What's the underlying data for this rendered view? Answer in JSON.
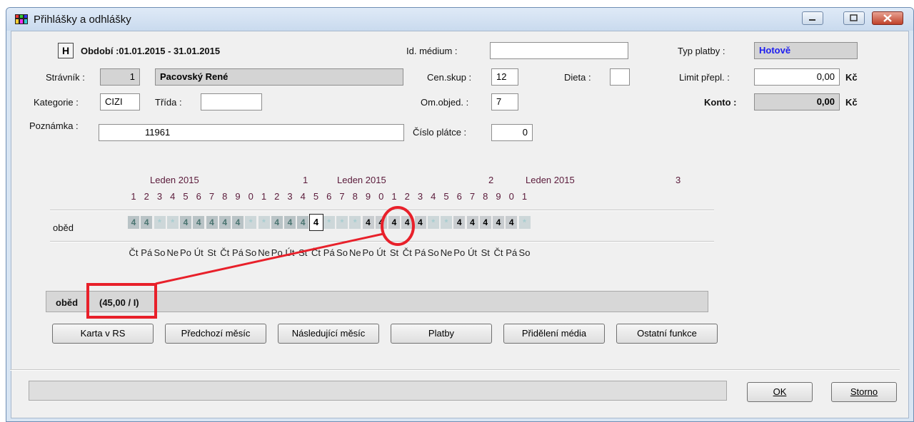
{
  "window": {
    "title": "Přihlášky a odhlášky"
  },
  "header": {
    "h_button": "H",
    "period": "Období :01.01.2015 - 31.01.2015",
    "id_medium_label": "Id. médium :",
    "id_medium_value": "",
    "typ_platby_label": "Typ platby :",
    "typ_platby_value": "Hotově",
    "stravnik_label": "Strávník :",
    "stravnik_id": "1",
    "stravnik_name": "Pacovský René",
    "censkup_label": "Cen.skup :",
    "censkup_value": "12",
    "dieta_label": "Dieta :",
    "dieta_value": "",
    "limit_label": "Limit přepl. :",
    "limit_value": "0,00",
    "limit_currency": "Kč",
    "kategorie_label": "Kategorie :",
    "kategorie_value": "CIZI",
    "trida_label": "Třída :",
    "trida_value": "",
    "omobjed_label": "Om.objed. :",
    "omobjed_value": "7",
    "konto_label": "Konto :",
    "konto_value": "0,00",
    "konto_currency": "Kč",
    "poznamka_label": "Poznámka :",
    "poznamka_value": "11961",
    "cislo_platce_label": "Číslo plátce :",
    "cislo_platce_value": "0"
  },
  "calendar": {
    "month_labels": [
      "Leden 2015",
      "Leden 2015",
      "Leden 2015"
    ],
    "decade_marks": [
      "1",
      "2",
      "3"
    ],
    "days": [
      "1",
      "2",
      "3",
      "4",
      "5",
      "6",
      "7",
      "8",
      "9",
      "0",
      "1",
      "2",
      "3",
      "4",
      "5",
      "6",
      "7",
      "8",
      "9",
      "0",
      "1",
      "2",
      "3",
      "4",
      "5",
      "6",
      "7",
      "8",
      "9",
      "0",
      "1"
    ],
    "weekdays": [
      "Čt",
      "Pá",
      "So",
      "Ne",
      "Po",
      "Út",
      "St",
      "Čt",
      "Pá",
      "So",
      "Ne",
      "Po",
      "Út",
      "St",
      "Čt",
      "Pá",
      "So",
      "Ne",
      "Po",
      "Út",
      "St",
      "Čt",
      "Pá",
      "So",
      "Ne",
      "Po",
      "Út",
      "St",
      "Čt",
      "Pá",
      "So"
    ],
    "row_label": "oběd",
    "cells": [
      "4",
      "4",
      "*",
      "*",
      "4",
      "4",
      "4",
      "4",
      "4",
      "*",
      "*",
      "4",
      "4",
      "4",
      "4",
      "*",
      "*",
      "*",
      "4",
      "4",
      "4",
      "4",
      "4",
      "*",
      "*",
      "4",
      "4",
      "4",
      "4",
      "4",
      "*"
    ],
    "cell_states": [
      "g",
      "g",
      "w",
      "w",
      "g",
      "g",
      "g",
      "g",
      "g",
      "w",
      "w",
      "g",
      "g",
      "g",
      "sel",
      "w",
      "w",
      "w",
      "b",
      "b",
      "b",
      "b",
      "b",
      "w",
      "w",
      "b",
      "b",
      "b",
      "b",
      "b",
      "w"
    ]
  },
  "detail": {
    "meal": "oběd",
    "price": "(45,00 / I)"
  },
  "buttons": {
    "karta": "Karta v RS",
    "predchozi": "Předchozí měsíc",
    "nasledujici": "Následující měsíc",
    "platby": "Platby",
    "prideleni": "Přidělení média",
    "ostatni": "Ostatní funkce",
    "ok": "OK",
    "storno": "Storno"
  },
  "colors": {
    "highlight": "#e8202a",
    "payment_text": "#1d1df0"
  },
  "icons": {
    "app": "app-icon",
    "minimize": "minimize-icon",
    "maximize": "maximize-icon",
    "close": "close-icon"
  }
}
